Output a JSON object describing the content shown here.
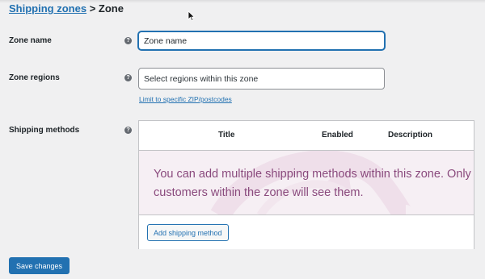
{
  "breadcrumb": {
    "parent_label": "Shipping zones",
    "separator": ">",
    "current_label": "Zone"
  },
  "form": {
    "zone_name": {
      "label": "Zone name",
      "help_icon": "question-circle-icon",
      "value": "Zone name"
    },
    "zone_regions": {
      "label": "Zone regions",
      "help_icon": "question-circle-icon",
      "placeholder": "Select regions within this zone",
      "postcode_link": "Limit to specific ZIP/postcodes"
    },
    "shipping_methods": {
      "label": "Shipping methods",
      "help_icon": "question-circle-icon",
      "columns": [
        "Title",
        "Enabled",
        "Description"
      ],
      "empty_message": "You can add multiple shipping methods within this zone. Only customers within the zone will see them.",
      "add_button_label": "Add shipping method"
    }
  },
  "actions": {
    "save_label": "Save changes"
  },
  "colors": {
    "accent": "#2271b1",
    "empty_state_bg": "#f6eff4",
    "empty_state_text": "#8a4a7d",
    "page_bg": "#f0f0f1"
  }
}
